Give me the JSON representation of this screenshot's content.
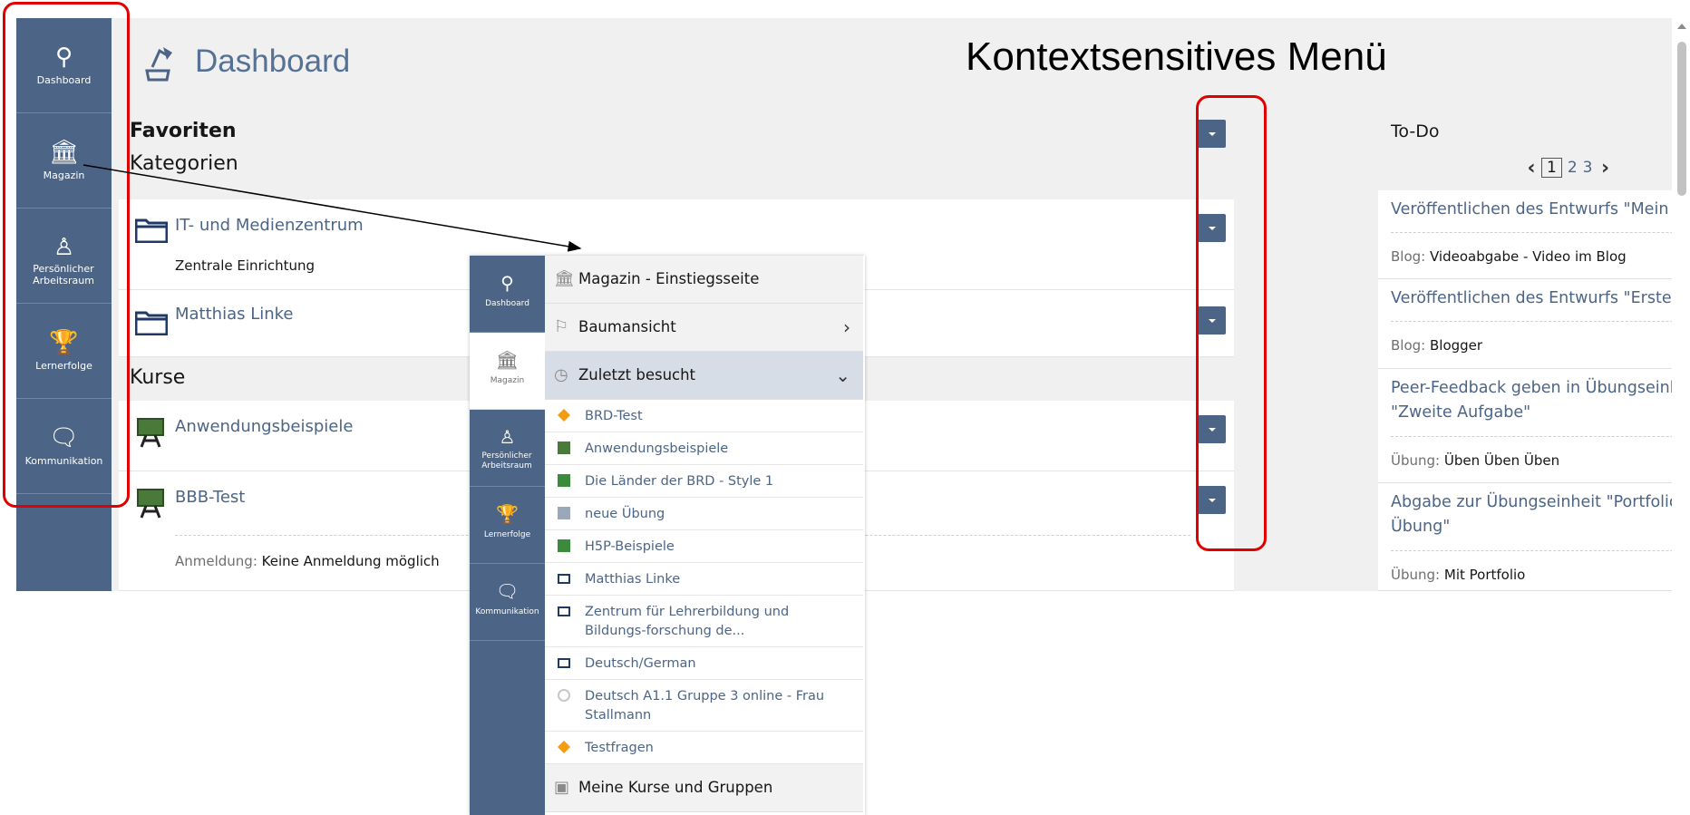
{
  "mainbar": {
    "items": [
      {
        "label": "Dashboard",
        "icon": "dashboard-icon"
      },
      {
        "label": "Magazin",
        "icon": "magazin-icon"
      },
      {
        "label": "Persönlicher Arbeitsraum",
        "icon": "person-icon"
      },
      {
        "label": "Lernerfolge",
        "icon": "trophy-icon"
      },
      {
        "label": "Kommunikation",
        "icon": "chat-icon"
      }
    ]
  },
  "header": {
    "title": "Dashboard"
  },
  "favorites": {
    "title": "Favoriten",
    "categories_title": "Kategorien",
    "categories": [
      {
        "name": "IT- und Medienzentrum",
        "sub": "Zentrale Einrichtung"
      },
      {
        "name": "Matthias Linke"
      }
    ],
    "courses_title": "Kurse",
    "courses": [
      {
        "name": "Anwendungsbeispiele"
      },
      {
        "name": "BBB-Test",
        "meta_key": "Anmeldung:",
        "meta_value": "Keine Anmeldung möglich"
      }
    ]
  },
  "todo": {
    "title": "To-Do",
    "pages": [
      "1",
      "2",
      "3"
    ],
    "current_page": "1",
    "items": [
      {
        "title": "Veröffentlichen des Entwurfs \"Mein Video\"",
        "meta_key": "Blog:",
        "meta_value": "Videoabgabe - Video im Blog"
      },
      {
        "title": "Veröffentlichen des Entwurfs \"Erster Beitrag\"",
        "meta_key": "Blog:",
        "meta_value": "Blogger"
      },
      {
        "title": "Peer-Feedback geben in Übungseinheit \"Zweite Aufgabe\"",
        "meta_key": "Übung:",
        "meta_value": "Üben Üben Üben"
      },
      {
        "title": "Abgabe zur Übungseinheit \"Portfolio als Übung\"",
        "meta_key": "Übung:",
        "meta_value": "Mit Portfolio"
      }
    ]
  },
  "slate": {
    "bar_items": [
      {
        "label": "Dashboard"
      },
      {
        "label": "Magazin"
      },
      {
        "label": "Persönlicher Arbeitsraum"
      },
      {
        "label": "Lernerfolge"
      },
      {
        "label": "Kommunikation"
      }
    ],
    "home": "Magazin - Einstiegsseite",
    "tree": "Baumansicht",
    "recent": "Zuletzt besucht",
    "recent_items": [
      {
        "label": "BRD-Test",
        "icon": "test-icon"
      },
      {
        "label": "Anwendungsbeispiele",
        "icon": "course-icon"
      },
      {
        "label": "Die Länder der BRD - Style 1",
        "icon": "learning-module-icon"
      },
      {
        "label": "neue Übung",
        "icon": "exercise-icon"
      },
      {
        "label": "H5P-Beispiele",
        "icon": "learning-module-icon"
      },
      {
        "label": "Matthias Linke",
        "icon": "category-icon"
      },
      {
        "label": "Zentrum für Lehrerbildung und Bildungs-forschung de...",
        "icon": "category-icon"
      },
      {
        "label": "Deutsch/German",
        "icon": "category-icon"
      },
      {
        "label": "Deutsch A1.1 Gruppe 3 online - Frau Stallmann",
        "icon": "blocked-icon"
      },
      {
        "label": "Testfragen",
        "icon": "test-icon"
      }
    ],
    "my_courses": "Meine Kurse und Gruppen"
  },
  "annotation": {
    "text": "Kontextsensitives Menü",
    "color": "#e00000"
  },
  "colors": {
    "mainbar": "#4c6586",
    "link": "#4c6586",
    "header_title": "#557196"
  }
}
